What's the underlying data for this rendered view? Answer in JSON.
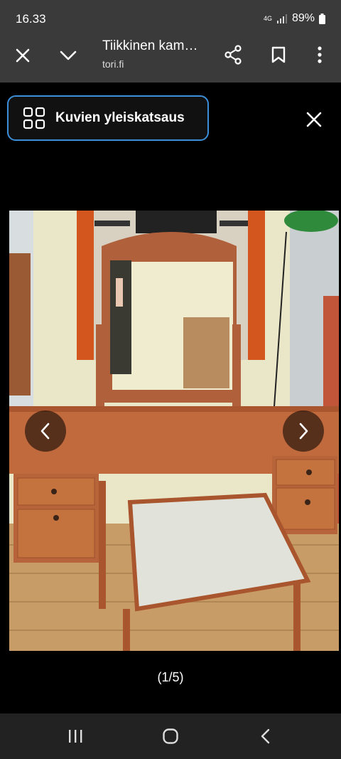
{
  "status": {
    "time": "16.33",
    "network": "4G",
    "battery": "89%"
  },
  "browser": {
    "title": "Tiikkinen kam…",
    "domain": "tori.fi"
  },
  "gallery": {
    "overview_label": "Kuvien yleiskatsaus",
    "counter": "(1/5)"
  },
  "icons": {
    "close": "close-icon",
    "collapse": "chevron-down-icon",
    "share": "share-icon",
    "bookmark": "bookmark-icon",
    "menu": "more-vert-icon",
    "grid": "grid-icon",
    "prev": "chevron-left-icon",
    "next": "chevron-right-icon",
    "recents": "recents-icon",
    "home": "home-icon",
    "back": "back-icon"
  }
}
